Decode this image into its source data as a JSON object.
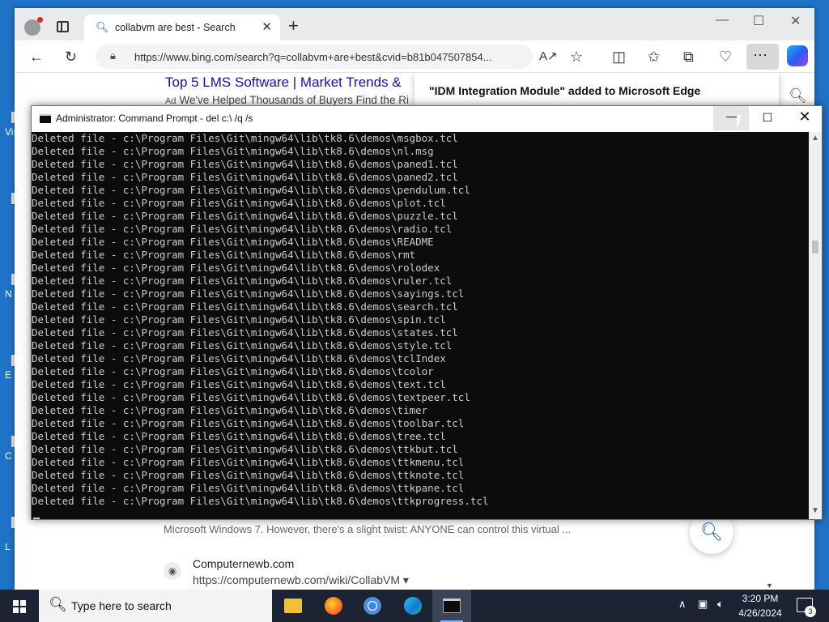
{
  "desktop": {
    "letters": [
      "Vis",
      "N",
      "E",
      "C",
      "L"
    ]
  },
  "browser": {
    "tab_title": "collabvm are best - Search",
    "url": "https://www.bing.com/search?q=collabvm+are+best&cvid=b81b047507854...",
    "notification": "\"IDM Integration Module\" added to Microsoft Edge",
    "ad": {
      "title": "Top 5 LMS Software | Market Trends &",
      "badge": "Ad",
      "description": "We've Helped Thousands of Buyers Find the Ri"
    },
    "snippet": "Microsoft Windows 7. However, there's a slight twist: ANYONE can control this virtual ...",
    "result": {
      "site_name": "Computernewb.com",
      "url": "https://computernewb.com/wiki/CollabVM",
      "caret": "▾"
    }
  },
  "cmd": {
    "title": "Administrator: Command Prompt - del  c:\\ /q /s",
    "lines": [
      "Deleted file - c:\\Program Files\\Git\\mingw64\\lib\\tk8.6\\demos\\msgbox.tcl",
      "Deleted file - c:\\Program Files\\Git\\mingw64\\lib\\tk8.6\\demos\\nl.msg",
      "Deleted file - c:\\Program Files\\Git\\mingw64\\lib\\tk8.6\\demos\\paned1.tcl",
      "Deleted file - c:\\Program Files\\Git\\mingw64\\lib\\tk8.6\\demos\\paned2.tcl",
      "Deleted file - c:\\Program Files\\Git\\mingw64\\lib\\tk8.6\\demos\\pendulum.tcl",
      "Deleted file - c:\\Program Files\\Git\\mingw64\\lib\\tk8.6\\demos\\plot.tcl",
      "Deleted file - c:\\Program Files\\Git\\mingw64\\lib\\tk8.6\\demos\\puzzle.tcl",
      "Deleted file - c:\\Program Files\\Git\\mingw64\\lib\\tk8.6\\demos\\radio.tcl",
      "Deleted file - c:\\Program Files\\Git\\mingw64\\lib\\tk8.6\\demos\\README",
      "Deleted file - c:\\Program Files\\Git\\mingw64\\lib\\tk8.6\\demos\\rmt",
      "Deleted file - c:\\Program Files\\Git\\mingw64\\lib\\tk8.6\\demos\\rolodex",
      "Deleted file - c:\\Program Files\\Git\\mingw64\\lib\\tk8.6\\demos\\ruler.tcl",
      "Deleted file - c:\\Program Files\\Git\\mingw64\\lib\\tk8.6\\demos\\sayings.tcl",
      "Deleted file - c:\\Program Files\\Git\\mingw64\\lib\\tk8.6\\demos\\search.tcl",
      "Deleted file - c:\\Program Files\\Git\\mingw64\\lib\\tk8.6\\demos\\spin.tcl",
      "Deleted file - c:\\Program Files\\Git\\mingw64\\lib\\tk8.6\\demos\\states.tcl",
      "Deleted file - c:\\Program Files\\Git\\mingw64\\lib\\tk8.6\\demos\\style.tcl",
      "Deleted file - c:\\Program Files\\Git\\mingw64\\lib\\tk8.6\\demos\\tclIndex",
      "Deleted file - c:\\Program Files\\Git\\mingw64\\lib\\tk8.6\\demos\\tcolor",
      "Deleted file - c:\\Program Files\\Git\\mingw64\\lib\\tk8.6\\demos\\text.tcl",
      "Deleted file - c:\\Program Files\\Git\\mingw64\\lib\\tk8.6\\demos\\textpeer.tcl",
      "Deleted file - c:\\Program Files\\Git\\mingw64\\lib\\tk8.6\\demos\\timer",
      "Deleted file - c:\\Program Files\\Git\\mingw64\\lib\\tk8.6\\demos\\toolbar.tcl",
      "Deleted file - c:\\Program Files\\Git\\mingw64\\lib\\tk8.6\\demos\\tree.tcl",
      "Deleted file - c:\\Program Files\\Git\\mingw64\\lib\\tk8.6\\demos\\ttkbut.tcl",
      "Deleted file - c:\\Program Files\\Git\\mingw64\\lib\\tk8.6\\demos\\ttkmenu.tcl",
      "Deleted file - c:\\Program Files\\Git\\mingw64\\lib\\tk8.6\\demos\\ttknote.tcl",
      "Deleted file - c:\\Program Files\\Git\\mingw64\\lib\\tk8.6\\demos\\ttkpane.tcl",
      "Deleted file - c:\\Program Files\\Git\\mingw64\\lib\\tk8.6\\demos\\ttkprogress.tcl"
    ]
  },
  "taskbar": {
    "search_placeholder": "Type here to search",
    "time": "3:20 PM",
    "date": "4/26/2024",
    "notification_count": "3",
    "apps": [
      "file-explorer-icon",
      "firefox-icon",
      "chrome-icon",
      "edge-icon",
      "command-prompt-icon"
    ]
  },
  "colors": {
    "desktop": "#1f73c6",
    "taskbar": "#1c2433",
    "console_bg": "#0c0c0c",
    "console_text": "#cccccc",
    "link": "#1a0dab"
  }
}
